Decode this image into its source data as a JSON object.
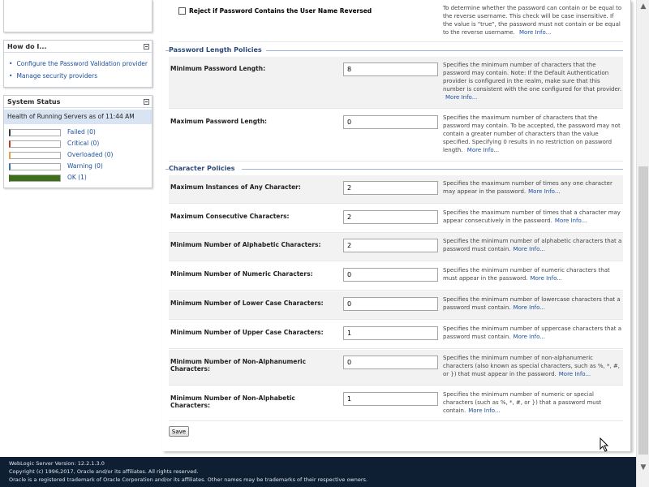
{
  "sidebar": {
    "howdoi": {
      "title": "How do I...",
      "links": [
        "Configure the Password Validation provider",
        "Manage security providers"
      ]
    },
    "system_status": {
      "title": "System Status",
      "health_label": "Health of Running Servers as of  11:44 AM",
      "rows": [
        {
          "label": "Failed (0)",
          "color": "#3a3a3a",
          "fill": 0
        },
        {
          "label": "Critical (0)",
          "color": "#c0392b",
          "fill": 0
        },
        {
          "label": "Overloaded (0)",
          "color": "#e8a33b",
          "fill": 0
        },
        {
          "label": "Warning (0)",
          "color": "#3a6fb0",
          "fill": 0
        },
        {
          "label": "OK (1)",
          "color": "#3f6e1b",
          "fill": 1
        }
      ]
    }
  },
  "main": {
    "reject_reversed": {
      "label": "Reject if Password Contains the User Name Reversed",
      "help": "To determine whether the password can contain or be equal to the reverse username. This check will be case insensitive. If the value is \"true\", the password must not contain or be equal to the reverse username.",
      "more": "More Info..."
    },
    "length_section": "Password Length Policies",
    "min_length": {
      "label": "Minimum Password Length:",
      "value": "8",
      "help": "Specifies the minimum number of characters that the password may contain. Note: If the Default Authentication provider is configured in the realm, make sure that this number is consistent with the one configured for that provider.",
      "more": "More Info..."
    },
    "max_length": {
      "label": "Maximum Password Length:",
      "value": "0",
      "help": "Specifies the maximum number of characters that the password may contain. To be accepted, the password may not contain a greater number of characters than the value specified. Specifying 0 results in no restriction on password length.",
      "more": "More Info..."
    },
    "char_section": "Character Policies",
    "char_rows": [
      {
        "label": "Maximum Instances of Any Character:",
        "value": "2",
        "help": "Specifies the maximum number of times any one character may appear in the password.",
        "more": "More Info..."
      },
      {
        "label": "Maximum Consecutive Characters:",
        "value": "2",
        "help": "Specifies the maximum number of times that a character may appear consecutively in the password.",
        "more": "More Info..."
      },
      {
        "label": "Minimum Number of Alphabetic Characters:",
        "value": "2",
        "help": "Specifies the minimum number of alphabetic characters that a password must contain.",
        "more": "More Info..."
      },
      {
        "label": "Minimum Number of Numeric Characters:",
        "value": "0",
        "help": "Specifies the minimum number of numeric characters that must appear in the password.",
        "more": "More Info..."
      },
      {
        "label": "Minimum Number of Lower Case Characters:",
        "value": "0",
        "help": "Specifies the minimum number of lowercase characters that a password must contain.",
        "more": "More Info..."
      },
      {
        "label": "Minimum Number of Upper Case Characters:",
        "value": "1",
        "help": "Specifies the minimum number of uppercase characters that a password must contain.",
        "more": "More Info..."
      },
      {
        "label": "Minimum Number of Non-Alphanumeric Characters:",
        "value": "0",
        "help": "Specifies the minimum number of non-alphanumeric characters (also known as special characters, such as %, *, #, or }) that must appear in the password.",
        "more": "More Info..."
      },
      {
        "label": "Minimum Number of Non-Alphabetic Characters:",
        "value": "1",
        "help": "Specifies the minimum number of numeric or special characters (such as %, *, #, or }) that a password must contain.",
        "more": "More Info..."
      }
    ],
    "save_label": "Save"
  },
  "footer": {
    "line1": "WebLogic Server Version: 12.2.1.3.0",
    "line2": "Copyright (c) 1996,2017, Oracle and/or its affiliates. All rights reserved.",
    "line3": "Oracle is a registered trademark of Oracle Corporation and/or its affiliates. Other names may be trademarks of their respective owners."
  }
}
